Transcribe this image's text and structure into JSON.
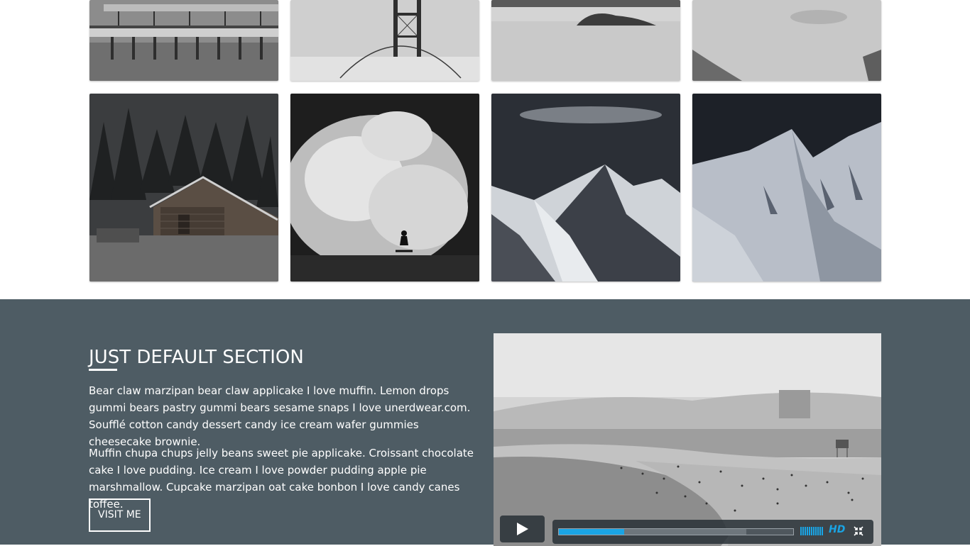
{
  "gallery": {
    "images": [
      {
        "subject": "pier-over-water"
      },
      {
        "subject": "golden-gate-bridge-in-fog"
      },
      {
        "subject": "island-in-calm-sea"
      },
      {
        "subject": "misty-cliffs"
      },
      {
        "subject": "log-cabin-in-forest"
      },
      {
        "subject": "surfer-in-wave-spray"
      },
      {
        "subject": "snowy-mountain-peaks"
      },
      {
        "subject": "snowy-mountain-ridge"
      }
    ]
  },
  "section": {
    "title": "JUST DEFAULT SECTION",
    "paragraph1": "Bear claw marzipan bear claw applicake I love muffin. Lemon drops gummi bears pastry gummi bears sesame snaps I love unerdwear.com. Soufflé cotton candy dessert candy ice cream wafer gummies cheesecake brownie.",
    "paragraph2": "Muffin chupa chups jelly beans sweet pie applicake. Croissant chocolate cake I love pudding. Ice cream I love powder pudding apple pie marshmallow. Cupcake marzipan oat cake bonbon I love candy canes toffee.",
    "button_label": "VISIT ME",
    "background_color": "#4e5c64"
  },
  "video": {
    "subject": "beach-scene",
    "progress_played": 0.28,
    "progress_buffered": 0.8,
    "volume_level": 1.0,
    "hd_label": "HD",
    "accent_color": "#1aa4e4",
    "icons": [
      "play-icon",
      "volume-icon",
      "fullscreen-exit-icon"
    ]
  }
}
